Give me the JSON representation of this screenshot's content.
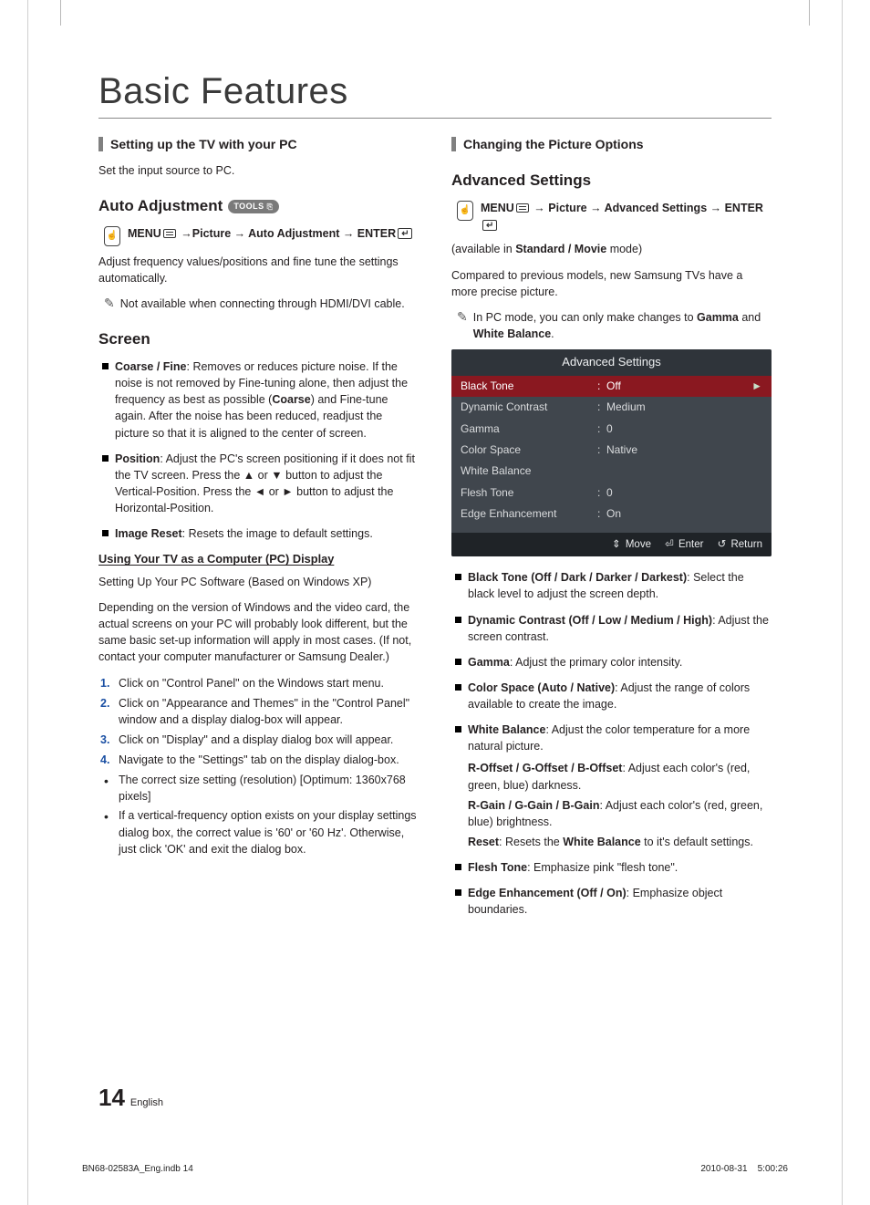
{
  "page": {
    "title": "Basic Features",
    "number": "14",
    "language": "English",
    "printmark_left": "BN68-02583A_Eng.indb   14",
    "printmark_right": "2010-08-31      5:00:26"
  },
  "left": {
    "section1_title": "Setting up the TV with your PC",
    "intro": "Set the input source to PC.",
    "auto_adj_heading": "Auto Adjustment",
    "tools_badge": "TOOLS",
    "menu_path": "MENU →Picture → Auto Adjustment → ENTER",
    "auto_adj_body": "Adjust frequency values/positions and fine tune the settings automatically.",
    "auto_adj_note": "Not available when connecting through HDMI/DVI cable.",
    "screen_heading": "Screen",
    "screen_items": [
      {
        "label": "Coarse / Fine",
        "body": ": Removes or reduces picture noise. If the noise is not removed by Fine-tuning alone, then adjust the frequency as best as possible (Coarse) and Fine-tune again. After the noise has been reduced, readjust the picture so that it is aligned to the center of screen."
      },
      {
        "label": "Position",
        "body": ": Adjust the PC's screen positioning if it does not fit the TV screen. Press the ▲ or ▼ button to adjust the Vertical-Position. Press the ◄ or ► button to adjust the Horizontal-Position."
      },
      {
        "label": "Image Reset",
        "body": ": Resets the image to default settings."
      }
    ],
    "pc_sub_h": "Using Your TV as a Computer (PC) Display",
    "pc_p1": "Setting Up Your PC Software (Based on Windows XP)",
    "pc_p2": "Depending on the version of Windows and the video card, the actual screens on your PC will probably look different, but the same basic set-up information will apply in most cases. (If not, contact your computer manufacturer or Samsung Dealer.)",
    "pc_steps": [
      "Click on \"Control Panel\" on the Windows start menu.",
      "Click on \"Appearance and Themes\" in the \"Control Panel\" window and a display dialog-box will appear.",
      "Click on \"Display\" and a display dialog box will appear.",
      "Navigate to the \"Settings\" tab on the display dialog-box."
    ],
    "pc_bullets": [
      "The correct size setting (resolution) [Optimum: 1360x768 pixels]",
      "If a vertical-frequency option exists on your display settings dialog box, the correct value is '60' or '60 Hz'. Otherwise, just click 'OK' and exit the dialog box."
    ]
  },
  "right": {
    "section_title": "Changing the Picture Options",
    "adv_heading": "Advanced Settings",
    "menu_path": "MENU → Picture → Advanced Settings → ENTER",
    "avail_prefix": "(available in ",
    "avail_bold": "Standard / Movie",
    "avail_suffix": " mode)",
    "adv_body": "Compared to previous models, new Samsung TVs have a more precise picture.",
    "adv_note_pre": "In PC mode, you can only make changes to ",
    "adv_note_b1": "Gamma",
    "adv_note_mid": " and ",
    "adv_note_b2": "White Balance",
    "adv_note_post": ".",
    "osd": {
      "title": "Advanced Settings",
      "rows": [
        {
          "label": "Black Tone",
          "value": "Off",
          "selected": true
        },
        {
          "label": "Dynamic Contrast",
          "value": "Medium"
        },
        {
          "label": "Gamma",
          "value": "0"
        },
        {
          "label": "Color Space",
          "value": "Native"
        },
        {
          "label": "White Balance",
          "value": ""
        },
        {
          "label": "Flesh Tone",
          "value": "0"
        },
        {
          "label": "Edge Enhancement",
          "value": "On"
        }
      ],
      "btn_move": "Move",
      "btn_enter": "Enter",
      "btn_return": "Return"
    },
    "items": [
      {
        "label": "Black Tone (Off / Dark / Darker / Darkest)",
        "body": ": Select the black level to adjust the screen depth."
      },
      {
        "label": "Dynamic Contrast (Off / Low / Medium / High)",
        "body": ": Adjust the screen contrast."
      },
      {
        "label": "Gamma",
        "body": ": Adjust the primary color intensity."
      },
      {
        "label": "Color Space (Auto / Native)",
        "body": ": Adjust the range of colors available to create the image."
      },
      {
        "label": "White Balance",
        "body": ": Adjust the color temperature for a more natural picture."
      },
      {
        "label": "Flesh Tone",
        "body": ": Emphasize pink \"flesh tone\"."
      },
      {
        "label": "Edge Enhancement (Off / On)",
        "body": ": Emphasize object boundaries."
      }
    ],
    "wb_sub": [
      {
        "label": "R-Offset / G-Offset / B-Offset",
        "body": ": Adjust each color's (red, green, blue) darkness."
      },
      {
        "label": "R-Gain / G-Gain / B-Gain",
        "body": ": Adjust each color's (red, green, blue) brightness."
      },
      {
        "label_pre": "Reset",
        "body_pre": ": Resets the ",
        "label_mid": "White Balance",
        "body_post": " to it's default settings."
      }
    ]
  }
}
